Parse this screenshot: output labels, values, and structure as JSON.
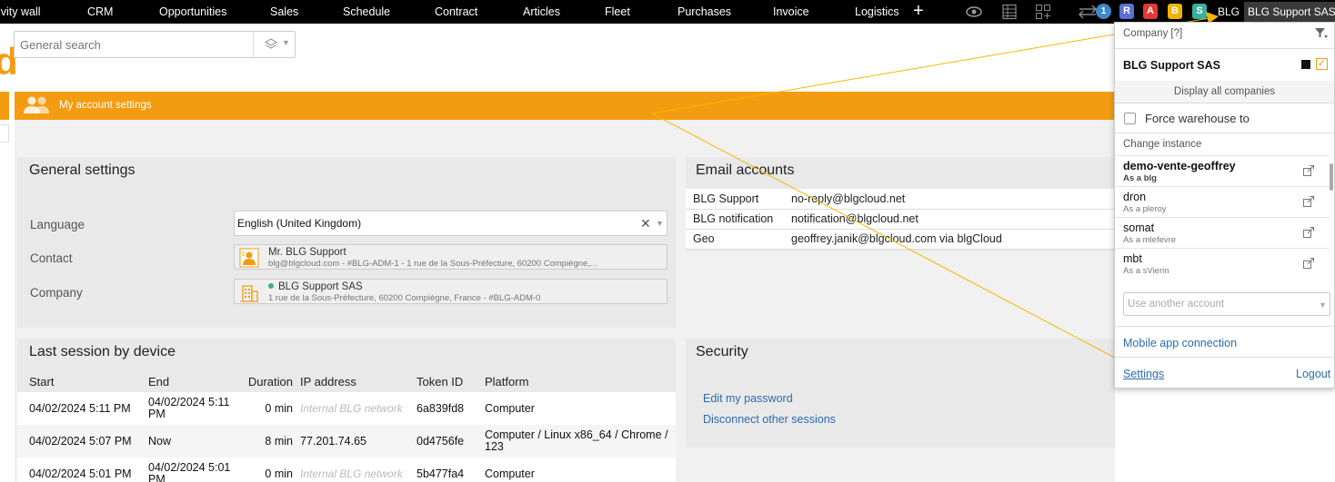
{
  "topbar": {
    "nav": [
      "ivity wall",
      "CRM",
      "Opportunities",
      "Sales",
      "Schedule",
      "Contract",
      "Articles",
      "Fleet",
      "Purchases",
      "Invoice",
      "Logistics"
    ],
    "plus": "+",
    "notification_count": "1",
    "letter_badges": [
      {
        "letter": "R",
        "color": "#5b6fd6"
      },
      {
        "letter": "A",
        "color": "#e53935"
      },
      {
        "letter": "B",
        "color": "#f0b400"
      },
      {
        "letter": "S",
        "color": "#3ab09e"
      }
    ],
    "blg": "BLG",
    "company": "BLG Support SAS",
    "icons": [
      "eye-icon",
      "spreadsheet-icon",
      "grid-plus-icon",
      "transfer-icon"
    ]
  },
  "header": {
    "logo_fragment": "d",
    "search_placeholder": "General search"
  },
  "banner": {
    "title": "My account settings"
  },
  "general_settings": {
    "title": "General settings",
    "language_label": "Language",
    "language_value": "English (United Kingdom)",
    "contact_label": "Contact",
    "contact_name": "Mr. BLG Support",
    "contact_detail": "blg@blgcloud.com - #BLG-ADM-1 - 1 rue de la Sous-Préfecture, 60200 Compiègne,...",
    "company_label": "Company",
    "company_name": "BLG Support SAS",
    "company_detail": "1 rue de la Sous-Préfecture, 60200 Compiègne, France - #BLG-ADM-0"
  },
  "email_accounts": {
    "title": "Email accounts",
    "rows": [
      {
        "name": "BLG Support",
        "email": "no-reply@blgcloud.net"
      },
      {
        "name": "BLG notification",
        "email": "notification@blgcloud.net"
      },
      {
        "name": "Geo",
        "email": "geoffrey.janik@blgcloud.com via blgCloud"
      }
    ]
  },
  "sessions": {
    "title": "Last session by device",
    "headers": [
      "Start",
      "End",
      "Duration",
      "IP address",
      "Token ID",
      "Platform"
    ],
    "rows": [
      {
        "start": "04/02/2024 5:11 PM",
        "end": "04/02/2024 5:11 PM",
        "duration": "0 min",
        "ip": "Internal BLG network",
        "token": "6a839fd8",
        "platform": "Computer"
      },
      {
        "start": "04/02/2024 5:07 PM",
        "end": "Now",
        "duration": "8 min",
        "ip": "77.201.74.65",
        "token": "0d4756fe",
        "platform": "Computer / Linux x86_64 / Chrome / 123"
      },
      {
        "start": "04/02/2024 5:01 PM",
        "end": "04/02/2024 5:01 PM",
        "duration": "0 min",
        "ip": "Internal BLG network",
        "token": "5b477fa4",
        "platform": "Computer"
      }
    ]
  },
  "security": {
    "title": "Security",
    "edit_password": "Edit my password",
    "disconnect": "Disconnect other sessions"
  },
  "dropdown": {
    "company_label": "Company [?]",
    "company_name": "BLG Support SAS",
    "display_all": "Display all companies",
    "force_warehouse": "Force warehouse to",
    "change_instance": "Change instance",
    "instances": [
      {
        "name": "demo-vente-geoffrey",
        "as": "As a blg",
        "current": true
      },
      {
        "name": "dron",
        "as": "As a pleroy",
        "current": false
      },
      {
        "name": "somat",
        "as": "As a mlefevre",
        "current": false
      },
      {
        "name": "mbt",
        "as": "As a sVierin",
        "current": false
      }
    ],
    "other_account_placeholder": "Use another account",
    "mobile_connection": "Mobile app connection",
    "settings": "Settings",
    "logout": "Logout"
  },
  "colors": {
    "accent": "#f39c12",
    "link": "#2b6cb0",
    "arrow": "#f5b800"
  }
}
